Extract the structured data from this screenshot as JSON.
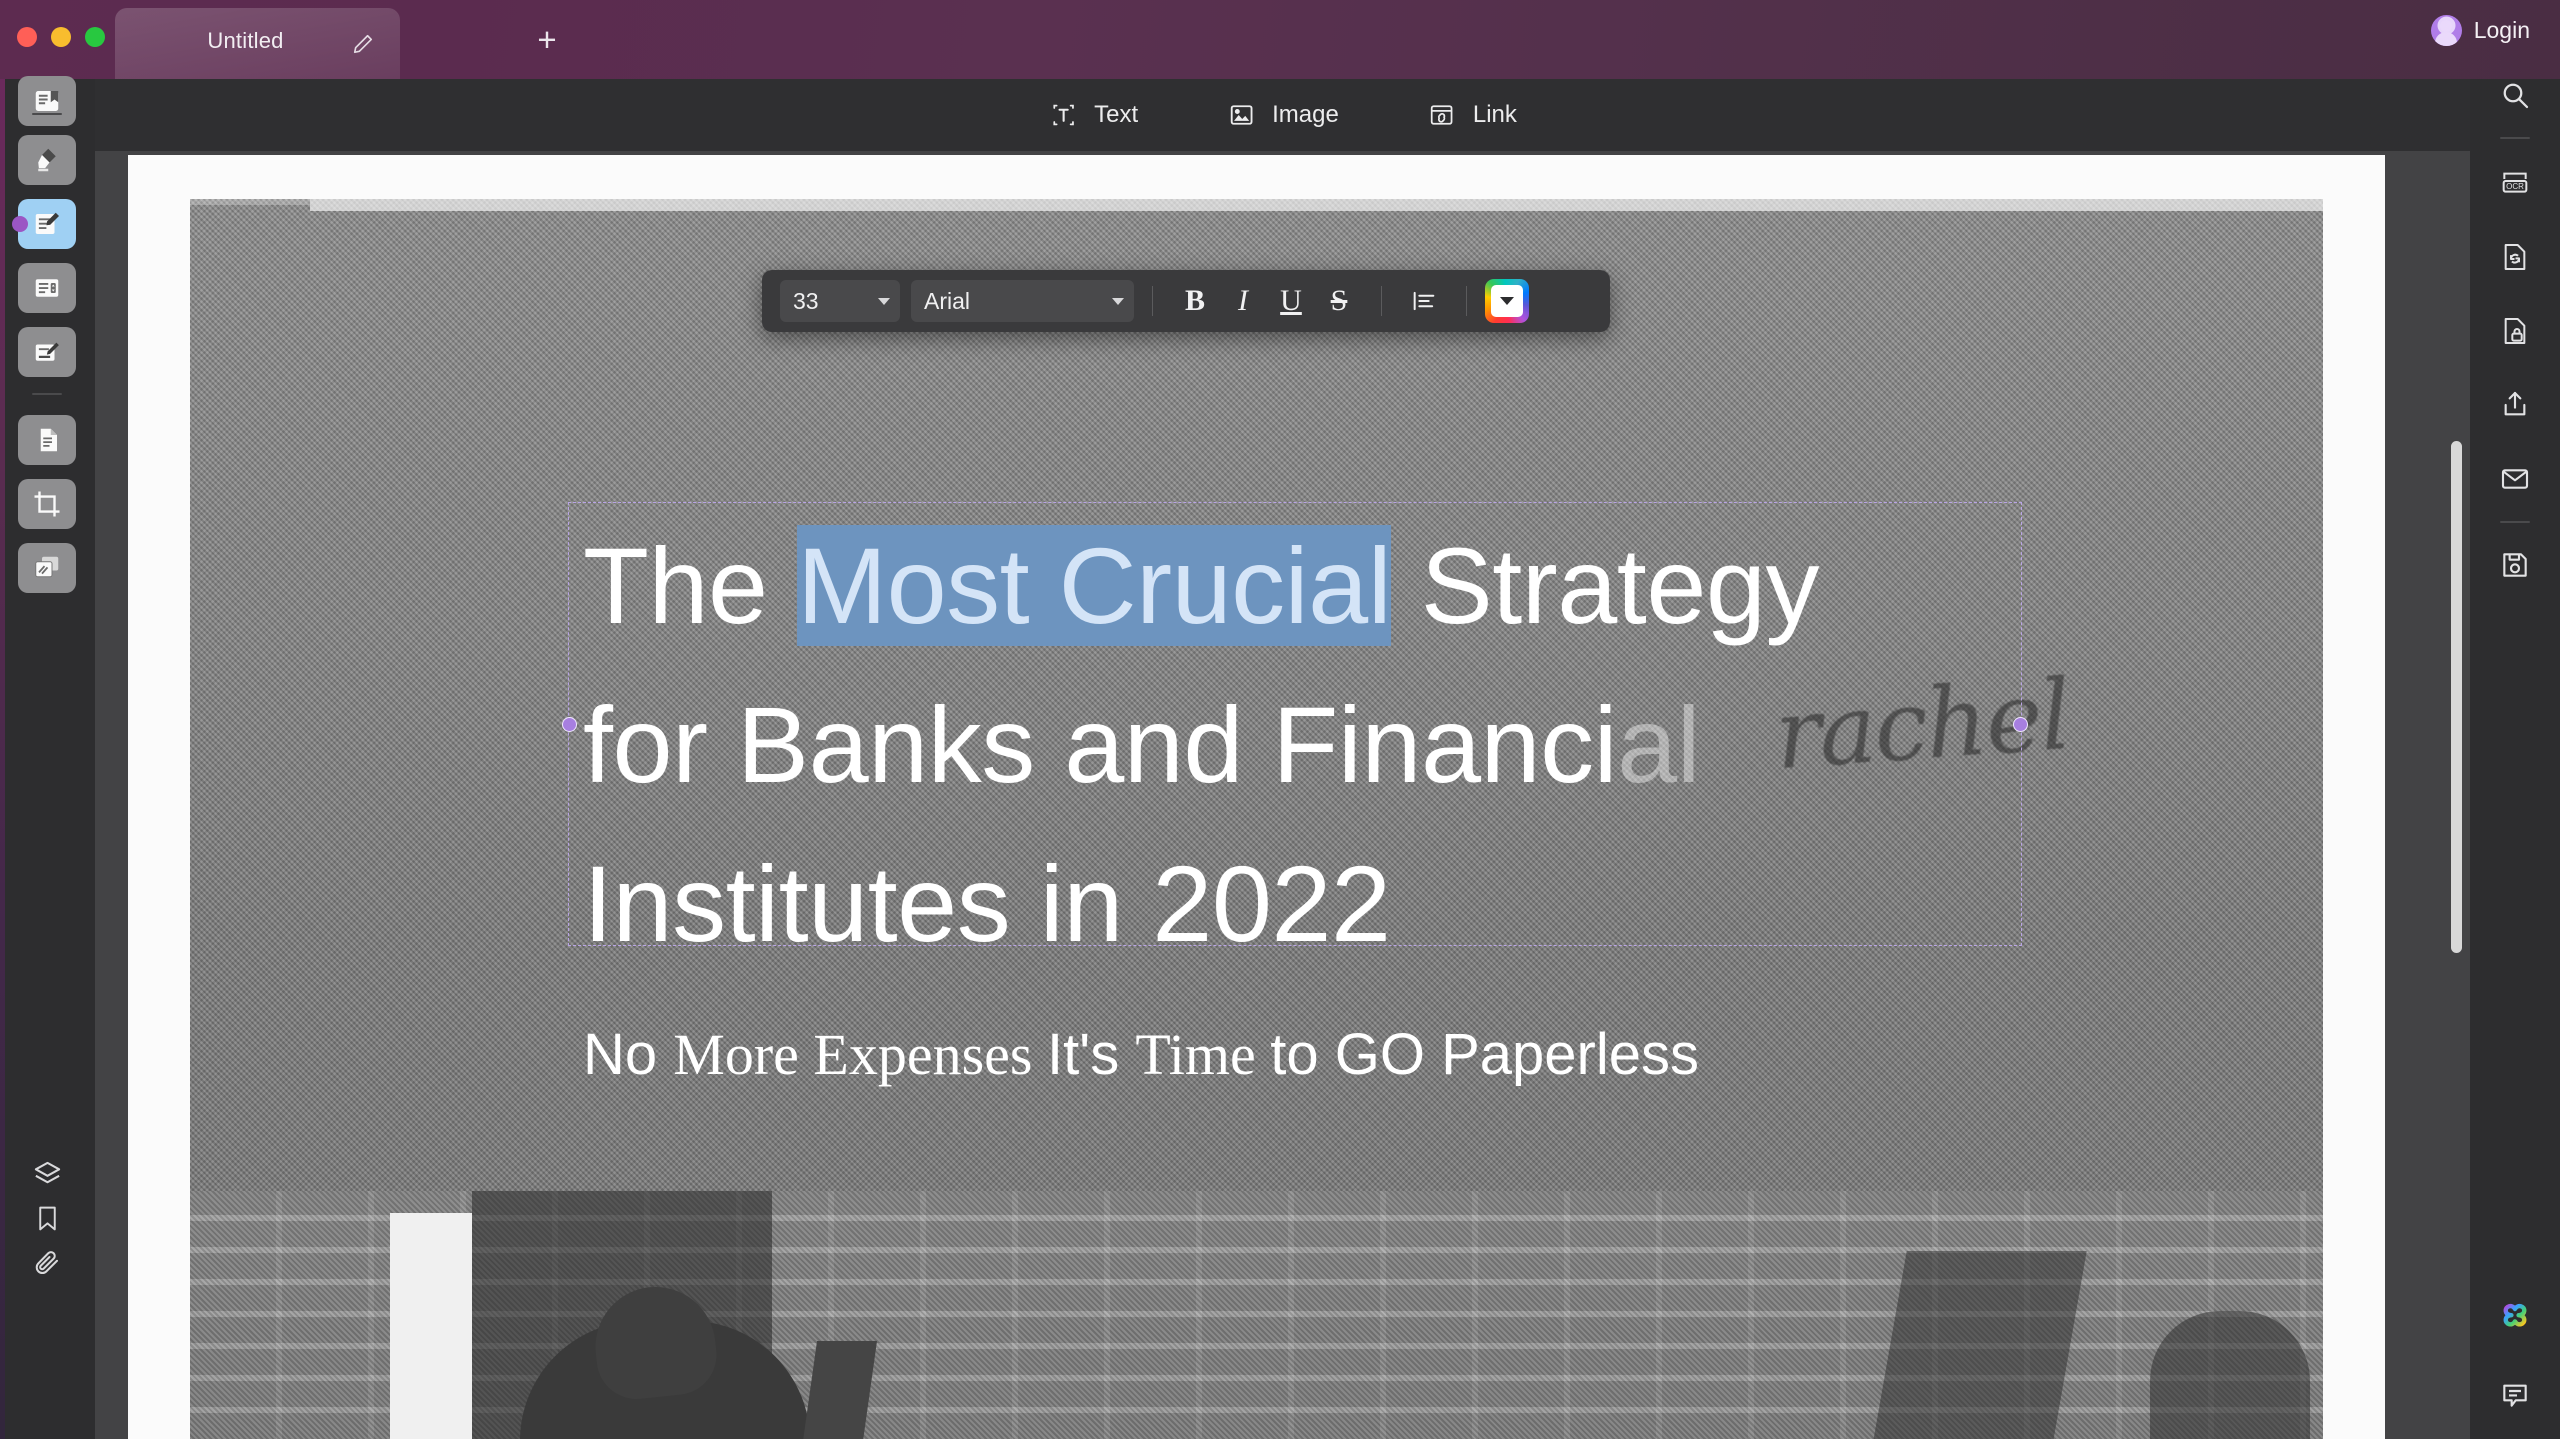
{
  "window": {
    "traffic_lights": [
      "close",
      "minimize",
      "zoom"
    ],
    "tab_title": "Untitled",
    "tab_edit_icon": "pencil-icon",
    "new_tab_icon": "plus-icon",
    "login_label": "Login",
    "avatar_icon": "user-avatar-icon"
  },
  "toolbar": {
    "items": [
      {
        "label": "Text",
        "icon": "text-tool-icon"
      },
      {
        "label": "Image",
        "icon": "image-tool-icon"
      },
      {
        "label": "Link",
        "icon": "link-tool-icon"
      }
    ]
  },
  "format_bar": {
    "font_size": "33",
    "font_family": "Arial",
    "bold": "B",
    "italic": "I",
    "underline": "U",
    "strikethrough": "S",
    "align_icon": "align-left-icon",
    "color_icon": "color-picker-icon"
  },
  "left_rail": {
    "items": [
      {
        "name": "read-mode",
        "icon": "book-read-icon"
      },
      {
        "name": "highlight-tool",
        "icon": "highlighter-icon"
      },
      {
        "name": "edit-text",
        "icon": "edit-document-icon",
        "active": true
      },
      {
        "name": "form-fields",
        "icon": "form-list-icon"
      },
      {
        "name": "annotate-sign",
        "icon": "sign-document-icon"
      },
      {
        "name": "organize-pages",
        "icon": "copy-pages-icon"
      },
      {
        "name": "crop-page",
        "icon": "crop-icon"
      },
      {
        "name": "slides-view",
        "icon": "stacked-cards-icon"
      }
    ],
    "bottom_items": [
      {
        "name": "layers",
        "icon": "layers-icon"
      },
      {
        "name": "bookmarks",
        "icon": "bookmark-icon"
      },
      {
        "name": "attachments",
        "icon": "paperclip-icon"
      }
    ]
  },
  "right_rail": {
    "items": [
      {
        "name": "search",
        "icon": "search-icon"
      },
      {
        "name": "ocr",
        "icon": "ocr-icon"
      },
      {
        "name": "convert",
        "icon": "convert-document-icon"
      },
      {
        "name": "protect",
        "icon": "lock-document-icon"
      },
      {
        "name": "share",
        "icon": "share-upload-icon"
      },
      {
        "name": "email",
        "icon": "envelope-icon"
      },
      {
        "name": "save",
        "icon": "floppy-save-icon"
      }
    ],
    "bottom_items": [
      {
        "name": "ai-assistant",
        "icon": "ai-clover-icon"
      },
      {
        "name": "feedback",
        "icon": "chat-bubble-icon"
      }
    ]
  },
  "document": {
    "headline": {
      "before_selection": "The ",
      "selection": "Most Crucial",
      "after_selection": " Strategy\nfor Banks and Financi",
      "faded_tail": "al",
      "line_three": "Institutes in 2022",
      "full_text": "The Most Crucial Strategy for Banks and Financial Institutes in 2022"
    },
    "subtitle_parts": [
      {
        "text": "No ",
        "style": "sans"
      },
      {
        "text": "More Expenses ",
        "style": "serif"
      },
      {
        "text": "It's ",
        "style": "sans"
      },
      {
        "text": "Time ",
        "style": "serif"
      },
      {
        "text": "to GO Paperless",
        "style": "sans"
      }
    ],
    "subtitle_full": "No More Expenses It's Time to GO Paperless",
    "background_handwriting": "rachel",
    "photo_caption": ""
  },
  "colors": {
    "titlebar_purple": "#5a2c50",
    "selection_blue": "#6d94bf",
    "selection_text": "#d4e4f7",
    "active_tool_blue": "#9fd0f3",
    "rail_bg": "#2d2d2f",
    "canvas_bg": "#434345",
    "handle_purple": "#a77fe0"
  }
}
